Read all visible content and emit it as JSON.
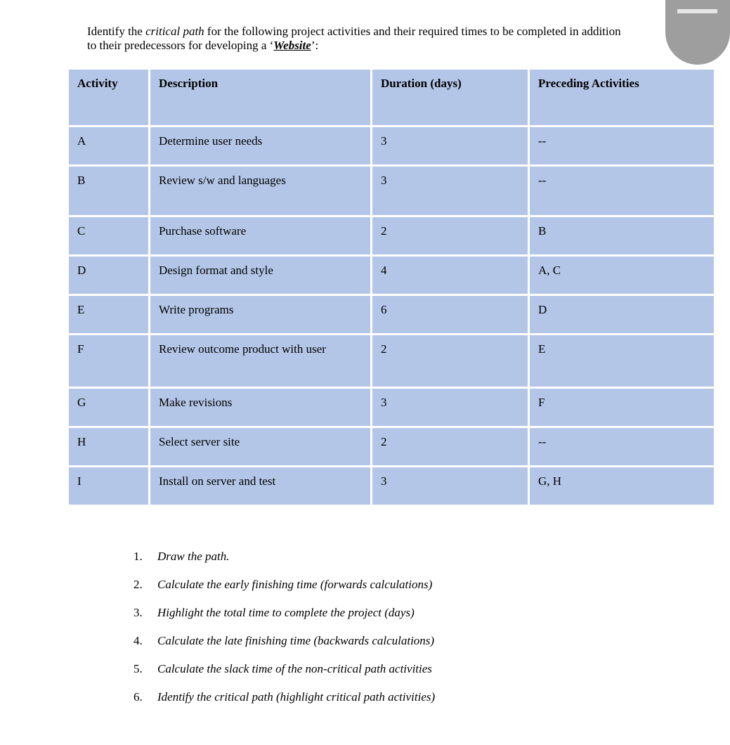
{
  "intro": {
    "part1": "Identify the ",
    "italic": "critical path",
    "part2": " for the following project activities and their required times to be completed in addition to their predecessors for developing a ‘",
    "project": "Website",
    "part3": "’:"
  },
  "badge": {
    "icon": "minimize-icon"
  },
  "table": {
    "headers": [
      "Activity",
      "Description",
      "Duration (days)",
      "Preceding Activities"
    ],
    "rows": [
      {
        "activity": "A",
        "description": "Determine user needs",
        "duration": "3",
        "preceding": "--"
      },
      {
        "activity": "B",
        "description": "Review s/w and languages",
        "duration": "3",
        "preceding": "--"
      },
      {
        "activity": "C",
        "description": "Purchase software",
        "duration": "2",
        "preceding": "B"
      },
      {
        "activity": "D",
        "description": "Design format and style",
        "duration": "4",
        "preceding": "A, C"
      },
      {
        "activity": "E",
        "description": "Write programs",
        "duration": "6",
        "preceding": "D"
      },
      {
        "activity": "F",
        "description": "Review outcome product with user",
        "duration": "2",
        "preceding": "E"
      },
      {
        "activity": "G",
        "description": "Make revisions",
        "duration": "3",
        "preceding": "F"
      },
      {
        "activity": "H",
        "description": "Select server site",
        "duration": "2",
        "preceding": "--"
      },
      {
        "activity": "I",
        "description": "Install on server and test",
        "duration": "3",
        "preceding": "G, H"
      }
    ]
  },
  "tasks": [
    {
      "num": "1.",
      "text": "Draw the path."
    },
    {
      "num": "2.",
      "text": "Calculate the early finishing time (forwards calculations)"
    },
    {
      "num": "3.",
      "text": "Highlight the total time to complete the project (days)"
    },
    {
      "num": "4.",
      "text": "Calculate the late finishing time (backwards calculations)"
    },
    {
      "num": "5.",
      "text": "Calculate the slack time of the non-critical path activities"
    },
    {
      "num": "6.",
      "text": "Identify the critical path (highlight critical path activities)"
    }
  ]
}
